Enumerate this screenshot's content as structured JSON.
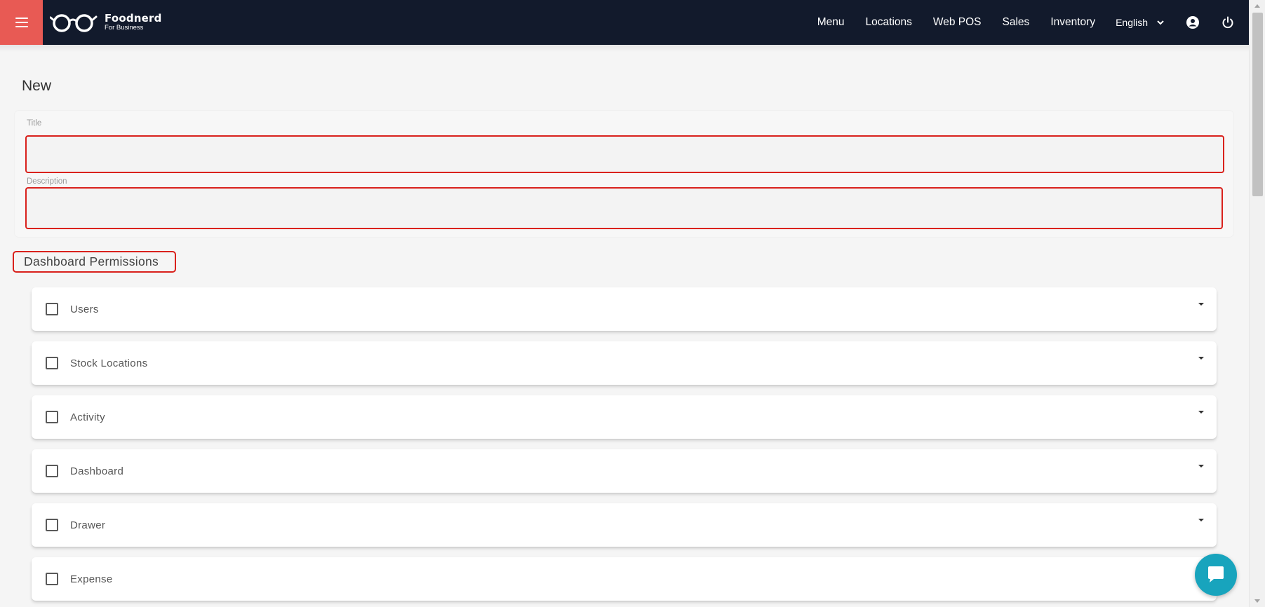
{
  "header": {
    "brand_name": "Foodnerd",
    "brand_sub": "For Business",
    "nav": [
      "Menu",
      "Locations",
      "Web POS",
      "Sales",
      "Inventory"
    ],
    "language": "English",
    "bg_color": "#121a2c",
    "accent_color": "#e85a54"
  },
  "page": {
    "title": "New"
  },
  "form": {
    "title_label": "Title",
    "title_value": "",
    "description_label": "Description",
    "description_value": "",
    "error_border_color": "#d9211c"
  },
  "permissions": {
    "section_title": "Dashboard Permissions",
    "items": [
      {
        "label": "Users",
        "checked": false
      },
      {
        "label": "Stock Locations",
        "checked": false
      },
      {
        "label": "Activity",
        "checked": false
      },
      {
        "label": "Dashboard",
        "checked": false
      },
      {
        "label": "Drawer",
        "checked": false
      },
      {
        "label": "Expense",
        "checked": false
      }
    ]
  },
  "icons": {
    "menu_toggle": "hamburger-icon",
    "logo": "glasses-logo-icon",
    "language_dropdown": "chevron-down-icon",
    "account": "account-circle-icon",
    "logout": "power-icon",
    "item_expand": "caret-down-icon",
    "chat": "chat-bubble-icon"
  }
}
